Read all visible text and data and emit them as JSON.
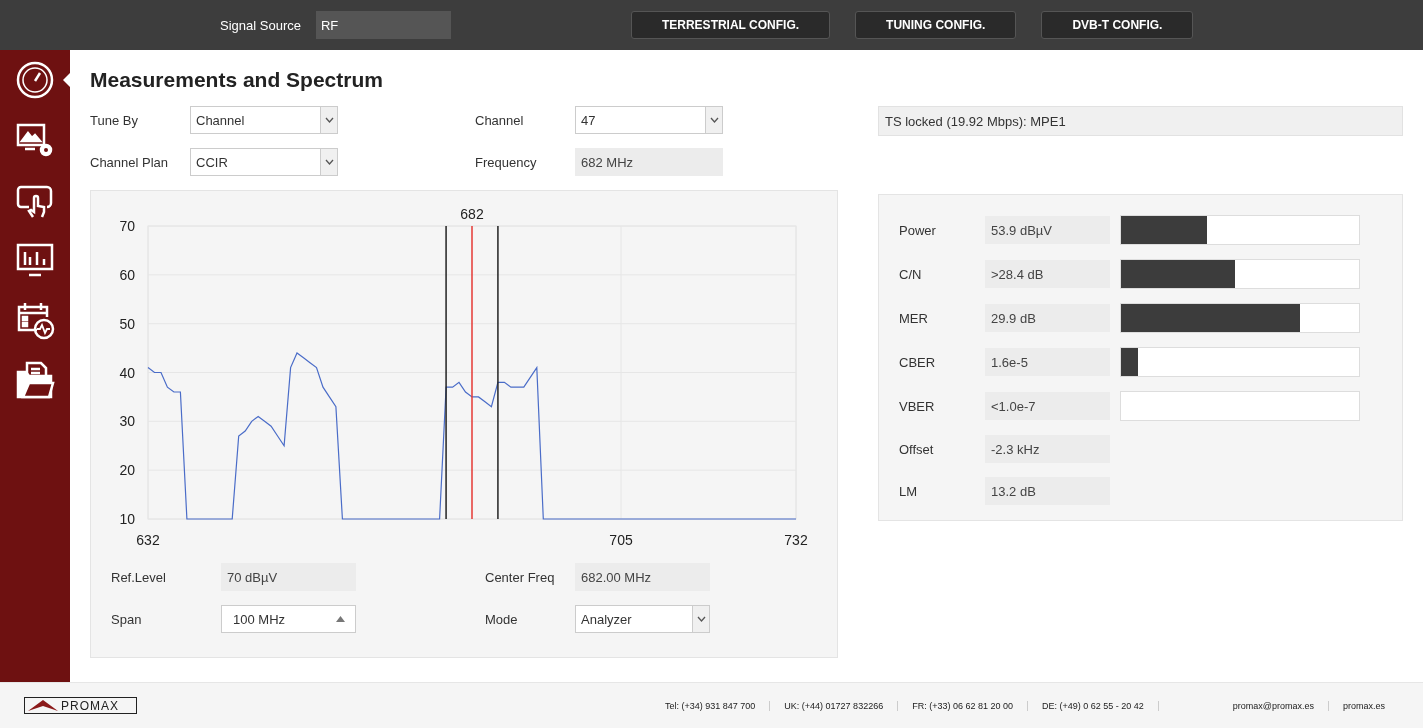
{
  "top_bar": {
    "signal_source_label": "Signal Source",
    "signal_source_value": "RF",
    "buttons": [
      "TERRESTRIAL CONFIG.",
      "TUNING CONFIG.",
      "DVB-T CONFIG."
    ]
  },
  "sidebar": {
    "items": [
      {
        "kind": "gauge",
        "selected": true
      },
      {
        "kind": "display-settings",
        "selected": false
      },
      {
        "kind": "touch",
        "selected": false
      },
      {
        "kind": "monitor-chart",
        "selected": false
      },
      {
        "kind": "calendar-wave",
        "selected": false
      },
      {
        "kind": "folder",
        "selected": false
      }
    ]
  },
  "page_title": "Measurements and Spectrum",
  "tuning": {
    "tune_by": {
      "label": "Tune By",
      "value": "Channel"
    },
    "channel_plan": {
      "label": "Channel Plan",
      "value": "CCIR"
    },
    "channel": {
      "label": "Channel",
      "value": "47"
    },
    "frequency": {
      "label": "Frequency",
      "value": "682 MHz"
    }
  },
  "status": "TS locked (19.92 Mbps): MPE1",
  "spectrum": {
    "chart_data": {
      "type": "line",
      "xlim": [
        632,
        732
      ],
      "ylim": [
        10,
        70
      ],
      "xticks": [
        632,
        705,
        732
      ],
      "yticks": [
        10,
        20,
        30,
        40,
        50,
        60,
        70
      ],
      "x": [
        632,
        633,
        634,
        635,
        636,
        637,
        638,
        645,
        646,
        647,
        648,
        649,
        650,
        651,
        652,
        653,
        654,
        655,
        656,
        657,
        658,
        659,
        660,
        661,
        662,
        677,
        678,
        679,
        680,
        681,
        682,
        683,
        684,
        685,
        686,
        687,
        688,
        689,
        690,
        691,
        692,
        693,
        732
      ],
      "grid": true,
      "series": [
        {
          "color": "#4a6cc8",
          "values": [
            41,
            40,
            40,
            37,
            36,
            36,
            10,
            10,
            27,
            28,
            30,
            31,
            30,
            29,
            27,
            25,
            41,
            44,
            43,
            42,
            41,
            37,
            35,
            33,
            10,
            10,
            37,
            37,
            38,
            36,
            35,
            35,
            34,
            33,
            38,
            38,
            37,
            37,
            37,
            39,
            41,
            10,
            10
          ]
        }
      ],
      "ref_lines": [
        {
          "axis": "x",
          "value": 678,
          "color": "#222222"
        },
        {
          "axis": "x",
          "value": 682,
          "label": "682",
          "color": "#e53935"
        },
        {
          "axis": "x",
          "value": 686,
          "color": "#222222"
        }
      ]
    },
    "ref_level": {
      "label": "Ref.Level",
      "value": "70 dBµV"
    },
    "span": {
      "label": "Span",
      "value": "100 MHz"
    },
    "center_freq": {
      "label": "Center Freq",
      "value": "682.00 MHz"
    },
    "mode": {
      "label": "Mode",
      "value": "Analyzer"
    }
  },
  "measurements": [
    {
      "label": "Power",
      "value": "53.9 dBµV",
      "kind": "bar",
      "level": 0.36
    },
    {
      "label": "C/N",
      "value": ">28.4 dB",
      "kind": "bar",
      "level": 0.48
    },
    {
      "label": "MER",
      "value": "29.9 dB",
      "kind": "bar",
      "level": 0.75
    },
    {
      "label": "CBER",
      "value": "1.6e-5",
      "kind": "bar",
      "level": 0.07
    },
    {
      "label": "VBER",
      "value": "<1.0e-7",
      "kind": "bar",
      "level": 0
    },
    {
      "label": "Offset",
      "value": "-2.3 kHz",
      "kind": "plain"
    },
    {
      "label": "LM",
      "value": "13.2 dB",
      "kind": "plain"
    }
  ],
  "footer": {
    "logo": "PROMAX",
    "contacts": [
      "Tel: (+34) 931 847 700",
      "UK: (+44) 01727 832266",
      "FR: (+33) 06 62 81 20 00",
      "DE: (+49) 0 62 55 - 20 42"
    ],
    "links": [
      "promax@promax.es",
      "promax.es"
    ]
  }
}
